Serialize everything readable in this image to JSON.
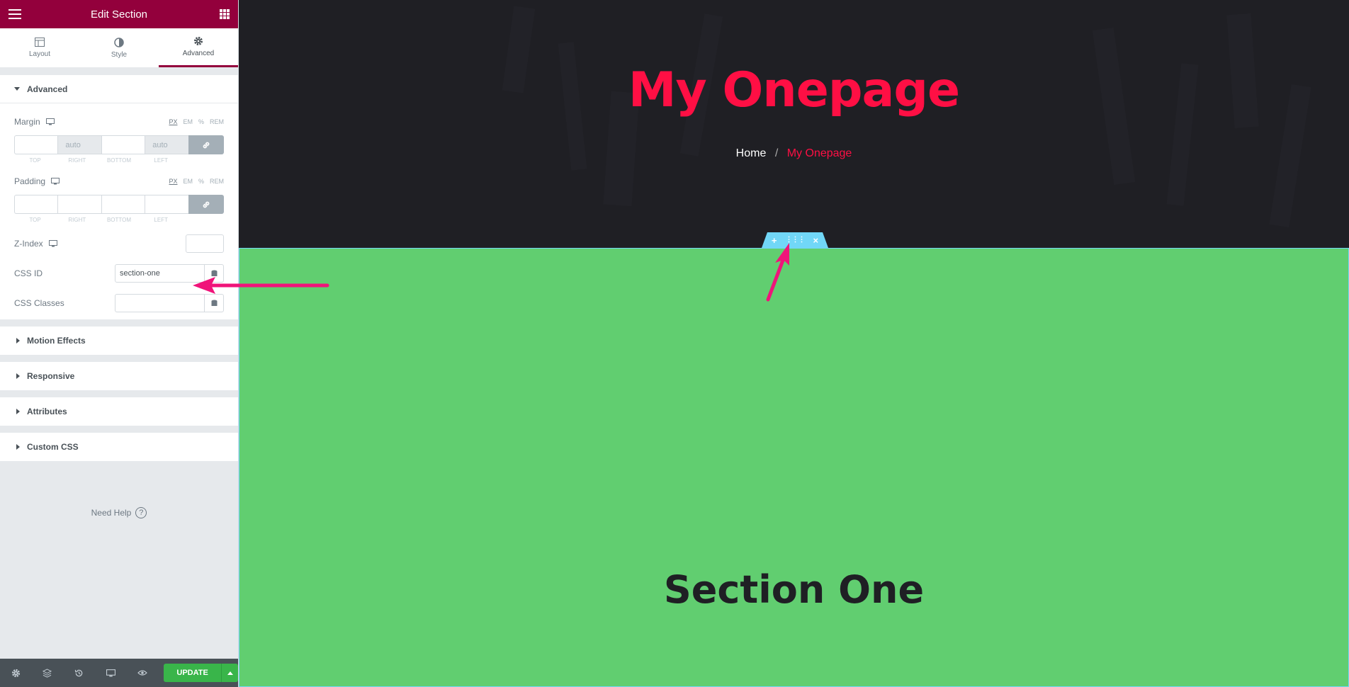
{
  "sidebar": {
    "title": "Edit Section",
    "tabs": [
      {
        "label": "Layout"
      },
      {
        "label": "Style"
      },
      {
        "label": "Advanced"
      }
    ],
    "advanced": {
      "heading": "Advanced",
      "margin": {
        "label": "Margin",
        "units": [
          "PX",
          "EM",
          "%",
          "REM"
        ],
        "values": [
          "",
          "auto",
          "",
          "auto"
        ],
        "sides": [
          "TOP",
          "RIGHT",
          "BOTTOM",
          "LEFT"
        ]
      },
      "padding": {
        "label": "Padding",
        "units": [
          "PX",
          "EM",
          "%",
          "REM"
        ],
        "values": [
          "",
          "",
          "",
          ""
        ],
        "sides": [
          "TOP",
          "RIGHT",
          "BOTTOM",
          "LEFT"
        ]
      },
      "zindex_label": "Z-Index",
      "css_id": {
        "label": "CSS ID",
        "value": "section-one"
      },
      "css_classes": {
        "label": "CSS Classes",
        "value": ""
      }
    },
    "collapsed_sections": [
      "Motion Effects",
      "Responsive",
      "Attributes",
      "Custom CSS"
    ],
    "help": "Need Help",
    "footer": {
      "update_label": "UPDATE"
    }
  },
  "preview": {
    "hero_title": "My Onepage",
    "breadcrumb": {
      "home": "Home",
      "separator": "/",
      "current": "My Onepage"
    },
    "section_title": "Section One"
  },
  "colors": {
    "brand": "#93003c",
    "accent_red": "#ff0f44",
    "section_green": "#61ce70",
    "handle_blue": "#71d7f7",
    "update_green": "#39b54a",
    "annotation_pink": "#f0147a"
  }
}
